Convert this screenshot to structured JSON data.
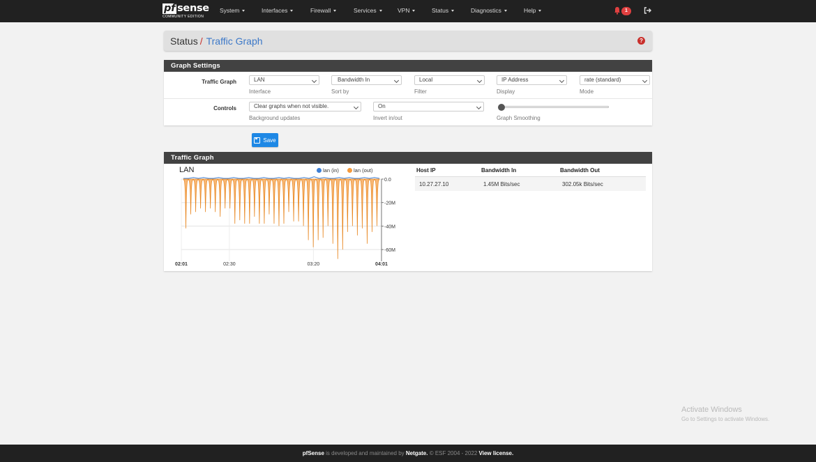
{
  "brand": {
    "name_pf": "pf",
    "name_rest": "sense",
    "edition": "COMMUNITY EDITION"
  },
  "nav": {
    "items": [
      "System",
      "Interfaces",
      "Firewall",
      "Services",
      "VPN",
      "Status",
      "Diagnostics",
      "Help"
    ],
    "notification_count": "1"
  },
  "breadcrumb": {
    "section": "Status",
    "separator": "/",
    "page": "Traffic Graph",
    "help": "?"
  },
  "settings": {
    "heading": "Graph Settings",
    "row1_label": "Traffic Graph",
    "interface": {
      "value": "LAN",
      "help": "Interface"
    },
    "sort_by": {
      "value": "Bandwidth In",
      "help": "Sort by"
    },
    "filter": {
      "value": "Local",
      "help": "Filter"
    },
    "display": {
      "value": "IP Address",
      "help": "Display"
    },
    "mode": {
      "value": "rate (standard)",
      "help": "Mode"
    },
    "row2_label": "Controls",
    "background_updates": {
      "value": "Clear graphs when not visible.",
      "help": "Background updates"
    },
    "invert": {
      "value": "On",
      "help": "Invert in/out"
    },
    "smoothing": {
      "help": "Graph Smoothing",
      "level": 0
    },
    "save_label": "Save"
  },
  "traffic": {
    "heading": "Traffic Graph",
    "graph_title": "LAN",
    "legend_in": "lan (in)",
    "legend_out": "lan (out)",
    "color_in": "#3d7fd6",
    "color_out": "#f59a3c",
    "table": {
      "headers": [
        "Host IP",
        "Bandwidth In",
        "Bandwidth Out"
      ],
      "rows": [
        {
          "ip": "10.27.27.10",
          "in": "1.45M Bits/sec",
          "out": "302.05k Bits/sec"
        }
      ]
    }
  },
  "chart_data": {
    "type": "area",
    "title": "LAN",
    "xlabel": "",
    "ylabel": "",
    "x_ticks": [
      "02:01",
      "02:30",
      "03:20",
      "04:01"
    ],
    "y_ticks": [
      "0.0",
      "-20M",
      "-40M",
      "-60M"
    ],
    "ylim": [
      -70,
      0
    ],
    "grid": true,
    "legend": "top-right",
    "series": [
      {
        "name": "lan (in)",
        "values": [
          0,
          0,
          1,
          0,
          1,
          0,
          0,
          1,
          0,
          0,
          1,
          0,
          0,
          1,
          0,
          0,
          1,
          0,
          0,
          1,
          0,
          1,
          0,
          0,
          1,
          0,
          2,
          0,
          1,
          0,
          0,
          1,
          0,
          1,
          0,
          0,
          1,
          0,
          1,
          0
        ]
      },
      {
        "name": "lan (out)",
        "values": [
          -42,
          -30,
          -28,
          -25,
          -28,
          -25,
          -28,
          -32,
          -25,
          -25,
          -38,
          -35,
          -38,
          -38,
          -32,
          -38,
          -38,
          -30,
          -38,
          -40,
          -38,
          -28,
          -36,
          -36,
          -40,
          -52,
          -58,
          -52,
          -50,
          -40,
          -55,
          -68,
          -60,
          -45,
          -40,
          -48,
          -42,
          -55,
          -45,
          -40
        ]
      }
    ]
  },
  "footer": {
    "pre": "is developed and maintained by",
    "brand": "pfSense",
    "company": "Netgate.",
    "copy": "© ESF 2004 - 2022",
    "license": "View license."
  },
  "watermark": {
    "line1": "Activate Windows",
    "line2": "Go to Settings to activate Windows."
  }
}
